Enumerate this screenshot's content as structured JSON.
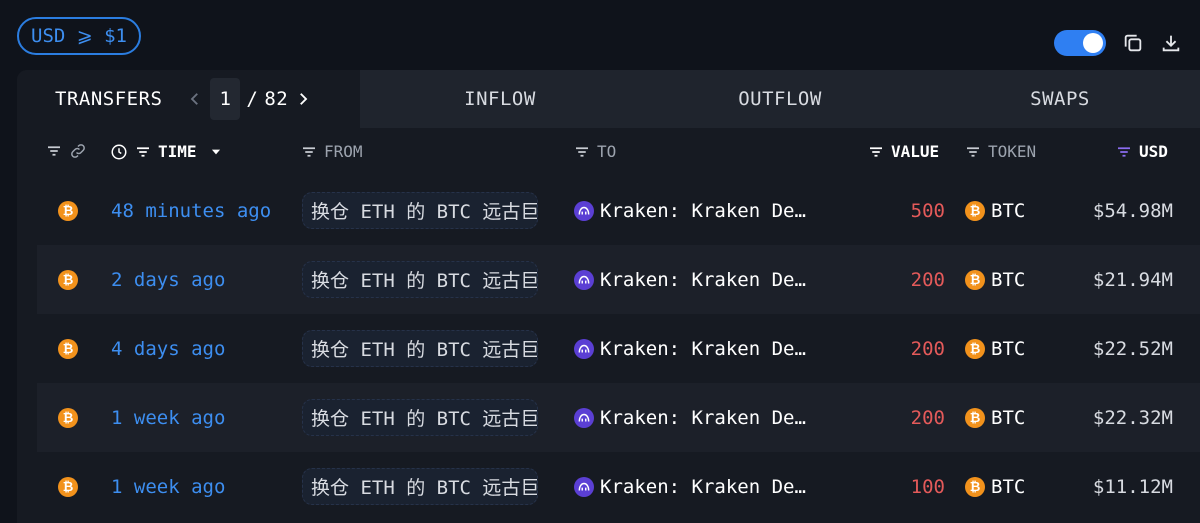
{
  "filter_chip": "USD ⩾ $1",
  "colors": {
    "accent": "#2f7ff2",
    "link": "#3d8ef0",
    "negative": "#e45a5a",
    "btc": "#f2921c",
    "kraken": "#5b3fd4"
  },
  "icons": {
    "toggle": "toggle-switch-on",
    "copy": "copy-icon",
    "download": "download-icon"
  },
  "tabs": {
    "transfers": "TRANSFERS",
    "inflow": "INFLOW",
    "outflow": "OUTFLOW",
    "swaps": "SWAPS"
  },
  "pager": {
    "current": "1",
    "separator": "/",
    "total": "82"
  },
  "columns": {
    "time": "TIME",
    "from": "FROM",
    "to": "TO",
    "value": "VALUE",
    "token": "TOKEN",
    "usd": "USD"
  },
  "rows": [
    {
      "time": "48 minutes ago",
      "from": "换仓 ETH 的 BTC 远古巨鲸",
      "to": "Kraken: Kraken De…",
      "value": "500",
      "token": "BTC",
      "usd": "$54.98M"
    },
    {
      "time": "2 days ago",
      "from": "换仓 ETH 的 BTC 远古巨鲸",
      "to": "Kraken: Kraken De…",
      "value": "200",
      "token": "BTC",
      "usd": "$21.94M"
    },
    {
      "time": "4 days ago",
      "from": "换仓 ETH 的 BTC 远古巨鲸",
      "to": "Kraken: Kraken De…",
      "value": "200",
      "token": "BTC",
      "usd": "$22.52M"
    },
    {
      "time": "1 week ago",
      "from": "换仓 ETH 的 BTC 远古巨鲸",
      "to": "Kraken: Kraken De…",
      "value": "200",
      "token": "BTC",
      "usd": "$22.32M"
    },
    {
      "time": "1 week ago",
      "from": "换仓 ETH 的 BTC 远古巨鲸",
      "to": "Kraken: Kraken De…",
      "value": "100",
      "token": "BTC",
      "usd": "$11.12M"
    }
  ]
}
